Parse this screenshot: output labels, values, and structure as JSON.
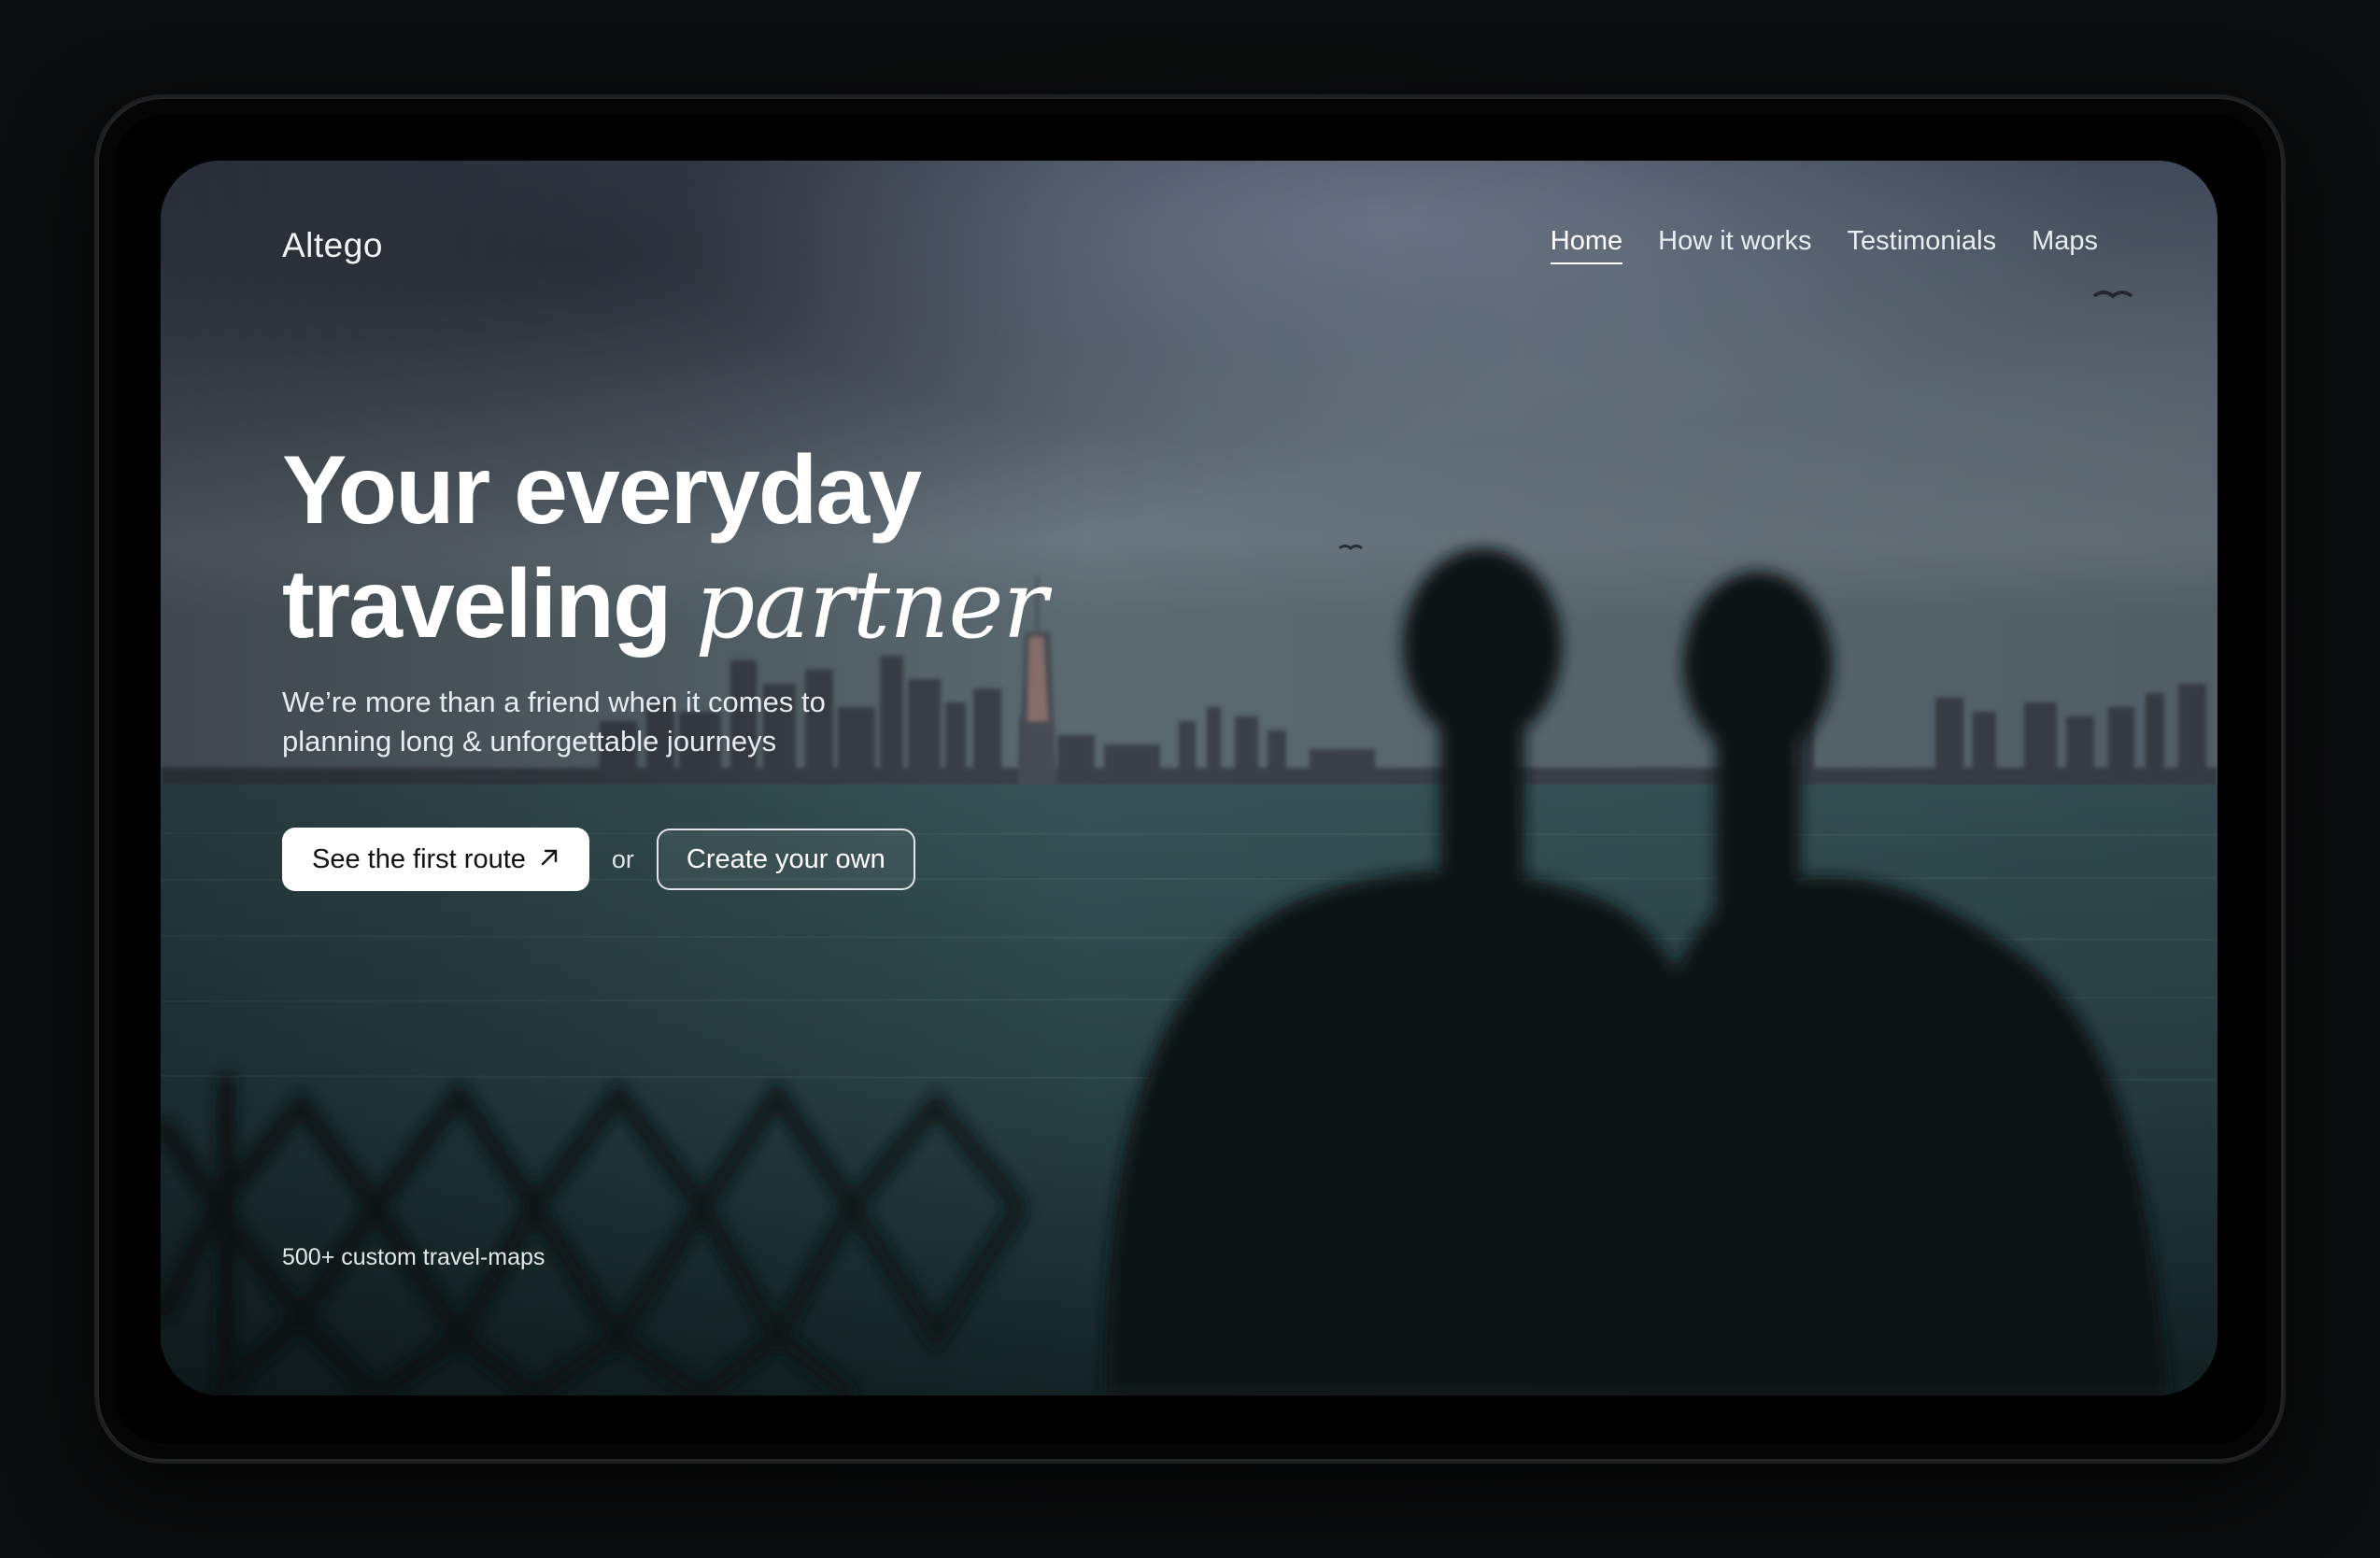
{
  "brand": {
    "name": "Altego"
  },
  "nav": {
    "items": [
      {
        "label": "Home",
        "active": true
      },
      {
        "label": "How it works",
        "active": false
      },
      {
        "label": "Testimonials",
        "active": false
      },
      {
        "label": "Maps",
        "active": false
      }
    ]
  },
  "hero": {
    "headline_line1": "Your everyday",
    "headline_line2_plain": "traveling",
    "headline_line2_italic": "partner",
    "subtitle": "We’re more than a friend when it comes to planning long & unforgettable journeys"
  },
  "cta": {
    "primary_label": "See the first route",
    "primary_icon": "arrow-up-right-icon",
    "separator": "or",
    "secondary_label": "Create your own"
  },
  "footnote": "500+ custom travel-maps",
  "colors": {
    "page_bg": "#0b0c0d",
    "device_frame": "#050505",
    "sky": "#5b6a7a",
    "water": "#2c4a4f",
    "silhouette": "#0e1417",
    "text": "#ffffff",
    "button_bg": "#ffffff"
  }
}
